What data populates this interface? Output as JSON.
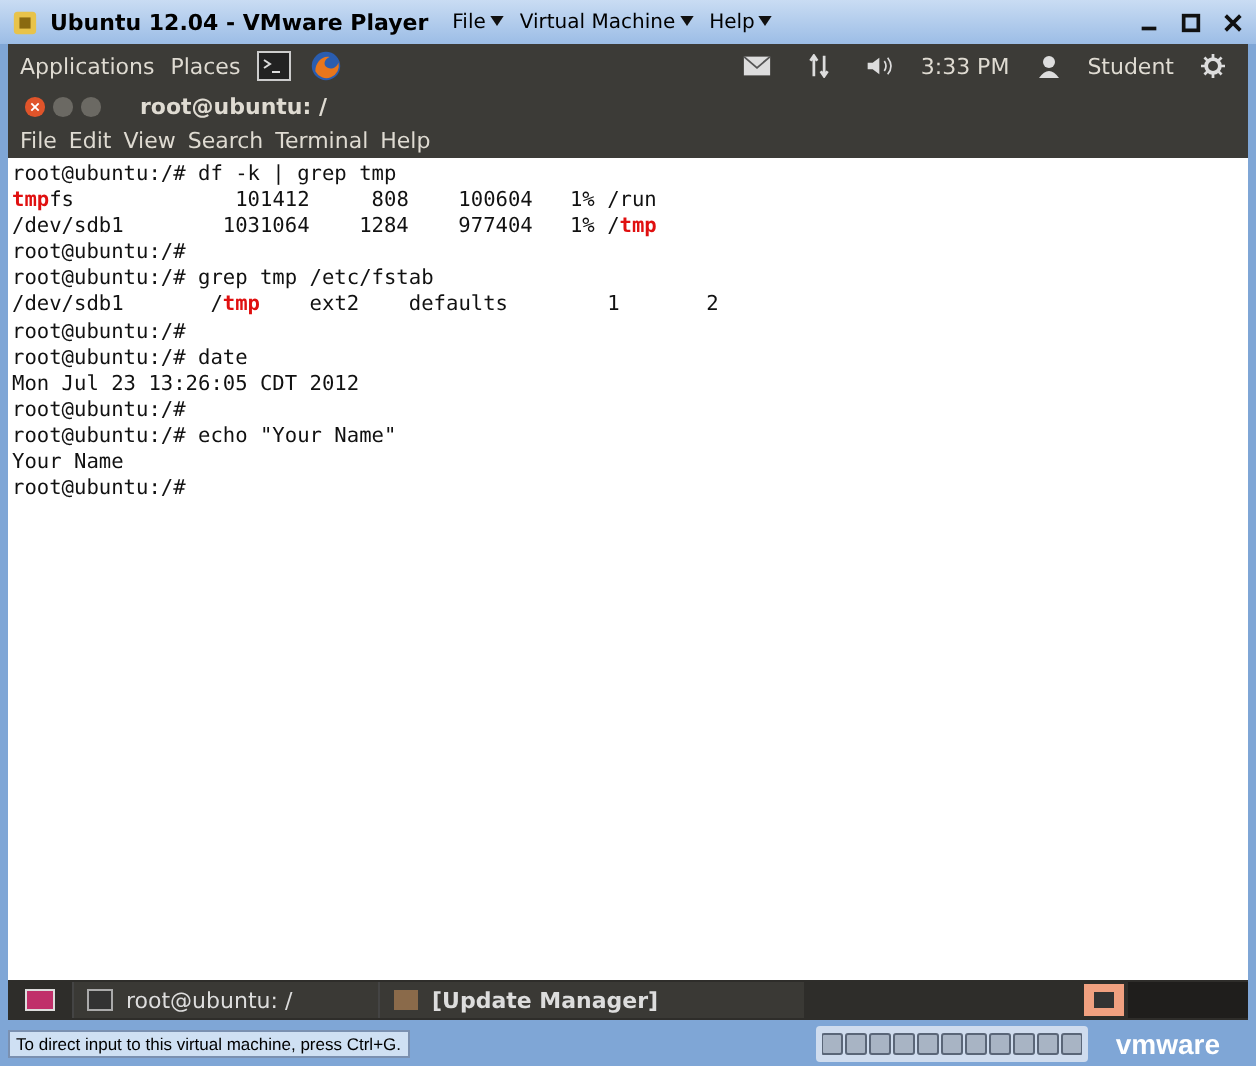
{
  "window": {
    "title": "Ubuntu 12.04 - VMware Player",
    "menu": [
      "File",
      "Virtual Machine",
      "Help"
    ]
  },
  "top_panel": {
    "menu": [
      "Applications",
      "Places"
    ],
    "clock": "3:33 PM",
    "user": "Student"
  },
  "terminal": {
    "title": "root@ubuntu: /",
    "menu": [
      "File",
      "Edit",
      "View",
      "Search",
      "Terminal",
      "Help"
    ],
    "lines": [
      [
        {
          "text": "root@ubuntu:/# df -k | grep tmp",
          "kind": "plain"
        }
      ],
      [
        {
          "text": "tmp",
          "kind": "match"
        },
        {
          "text": "fs             101412     808    100604   1% /run",
          "kind": "plain"
        }
      ],
      [
        {
          "text": "/dev/sdb1        1031064    1284    977404   1% /",
          "kind": "plain"
        },
        {
          "text": "tmp",
          "kind": "match"
        }
      ],
      [
        {
          "text": "root@ubuntu:/#",
          "kind": "plain"
        }
      ],
      [
        {
          "text": "root@ubuntu:/# grep tmp /etc/fstab",
          "kind": "plain"
        }
      ],
      [
        {
          "text": "/dev/sdb1       /",
          "kind": "plain"
        },
        {
          "text": "tmp",
          "kind": "match"
        },
        {
          "text": "    ext2    defaults        1       2",
          "kind": "plain"
        }
      ],
      [
        {
          "text": "root@ubuntu:/#",
          "kind": "plain"
        }
      ],
      [
        {
          "text": "root@ubuntu:/# date",
          "kind": "plain"
        }
      ],
      [
        {
          "text": "Mon Jul 23 13:26:05 CDT 2012",
          "kind": "plain"
        }
      ],
      [
        {
          "text": "root@ubuntu:/#",
          "kind": "plain"
        }
      ],
      [
        {
          "text": "root@ubuntu:/# echo \"Your Name\"",
          "kind": "plain"
        }
      ],
      [
        {
          "text": "Your Name",
          "kind": "plain"
        }
      ],
      [
        {
          "text": "root@ubuntu:/#",
          "kind": "plain"
        }
      ]
    ]
  },
  "taskbar": [
    {
      "label": "root@ubuntu: /",
      "kind": "terminal"
    },
    {
      "label": "[Update Manager]",
      "kind": "app"
    }
  ],
  "status_bar": {
    "hint": "To direct input to this virtual machine, press Ctrl+G.",
    "logo": "vmware"
  }
}
